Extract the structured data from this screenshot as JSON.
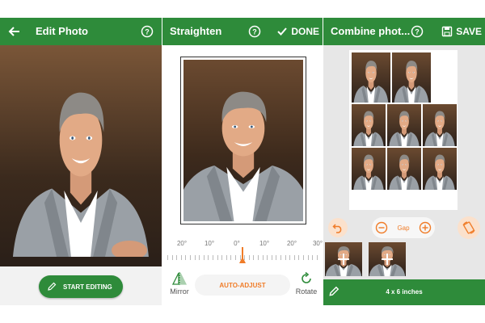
{
  "panels": {
    "edit": {
      "title": "Edit Photo",
      "edit_button": "START EDITING"
    },
    "straighten": {
      "title": "Straighten",
      "done_label": "DONE",
      "ruler_labels": [
        "20°",
        "10°",
        "0°",
        "10°",
        "20°",
        "30°"
      ],
      "mirror_label": "Mirror",
      "auto_adjust_label": "AUTO-ADJUST",
      "rotate_label": "Rotate"
    },
    "combine": {
      "title": "Combine phot...",
      "save_label": "SAVE",
      "gap_label": "Gap",
      "print_size": "4 x 6 inches"
    }
  },
  "icons": {
    "back": "arrow-left-icon",
    "help": "help-circle-icon",
    "done": "check-icon",
    "save": "floppy-disk-icon",
    "pencil": "pencil-icon",
    "mirror": "mirror-icon",
    "rotate": "rotate-icon",
    "undo": "undo-icon",
    "minus": "minus-circle-icon",
    "plus": "plus-circle-icon",
    "add": "plus-icon"
  },
  "colors": {
    "primary_green": "#2e8b3a",
    "accent_orange": "#f07c28",
    "panel_gray": "#e7e7e7"
  }
}
